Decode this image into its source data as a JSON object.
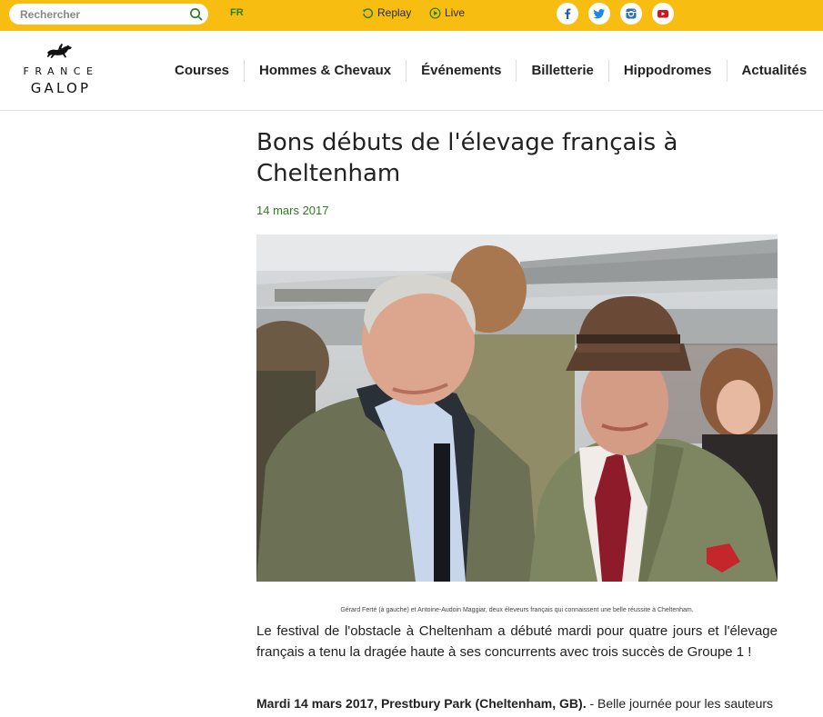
{
  "topbar": {
    "search_placeholder": "Rechercher",
    "language": "FR",
    "replay_label": "Replay",
    "live_label": "Live",
    "bar_color": "#f7bd10",
    "social_icons": [
      "facebook-icon",
      "twitter-icon",
      "instagram-icon",
      "youtube-icon"
    ]
  },
  "logo": {
    "line1": "FRANCE",
    "line2": "GALOP"
  },
  "nav": {
    "items": [
      "Courses",
      "Hommes & Chevaux",
      "Événements",
      "Billetterie",
      "Hippodromes",
      "Actualités"
    ]
  },
  "article": {
    "title": "Bons débuts de l'élevage français à Cheltenham",
    "date": "14 mars 2017",
    "caption": "Gérard Ferté (à gauche) et Antoine-Audoin Maggiar, deux éleveurs français qui connaissent une belle réussite à Cheltenham.",
    "lead": "Le festival de l'obstacle à Cheltenham a débuté mardi pour quatre jours et l'élevage français a tenu la dragée haute à ses concurrents avec trois succès de Groupe 1 !",
    "para_bold": "Mardi 14 mars 2017, Prestbury Park (Cheltenham, GB).",
    "para_text": " - Belle journée pour les sauteurs",
    "accent_color": "#2e7d1e"
  }
}
